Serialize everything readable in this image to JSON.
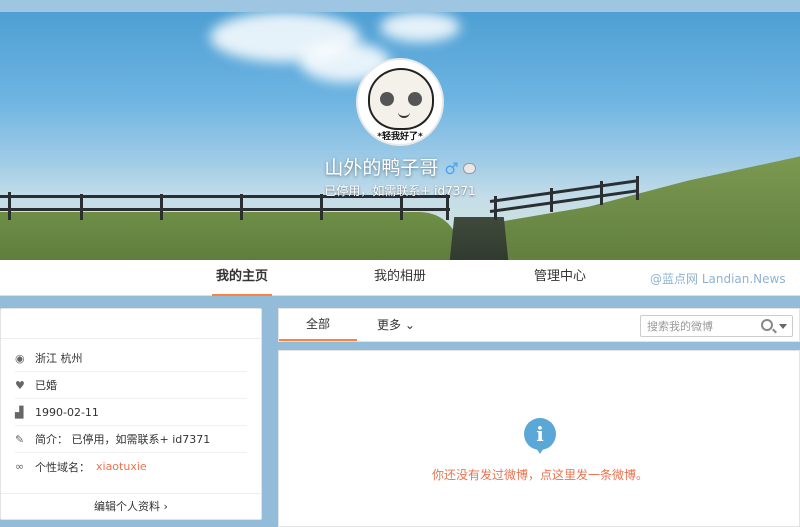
{
  "profile": {
    "avatar_caption": "*轻我好了*",
    "name": "山外的鸭子哥",
    "gender_symbol": "♂",
    "bio_line": "已停用，如需联系+ id7371"
  },
  "nav": {
    "items": [
      {
        "label": "我的主页"
      },
      {
        "label": "我的相册"
      },
      {
        "label": "管理中心"
      }
    ],
    "watermark": "@蓝点网 Landian.News"
  },
  "info": {
    "location": "浙江 杭州",
    "relationship": "已婚",
    "birthday": "1990-02-11",
    "bio": "简介： 已停用，如需联系+ id7371",
    "domain_label": "个性域名：",
    "domain_value": "xiaotuxie",
    "edit_label": "编辑个人资料  ›"
  },
  "feed": {
    "tab_all": "全部",
    "tab_more": "更多 ⌄",
    "search_placeholder": "搜索我的微博",
    "empty_message": "你还没有发过微博，点这里发一条微博。"
  },
  "icons": [
    "location-icon",
    "relationship-icon",
    "birthday-icon",
    "bio-icon",
    "link-icon",
    "search-icon",
    "info-icon"
  ],
  "colors": {
    "accent": "#ff8140",
    "link": "#eb7350",
    "gender": "#4aa3f0",
    "info": "#5aa7d8"
  }
}
